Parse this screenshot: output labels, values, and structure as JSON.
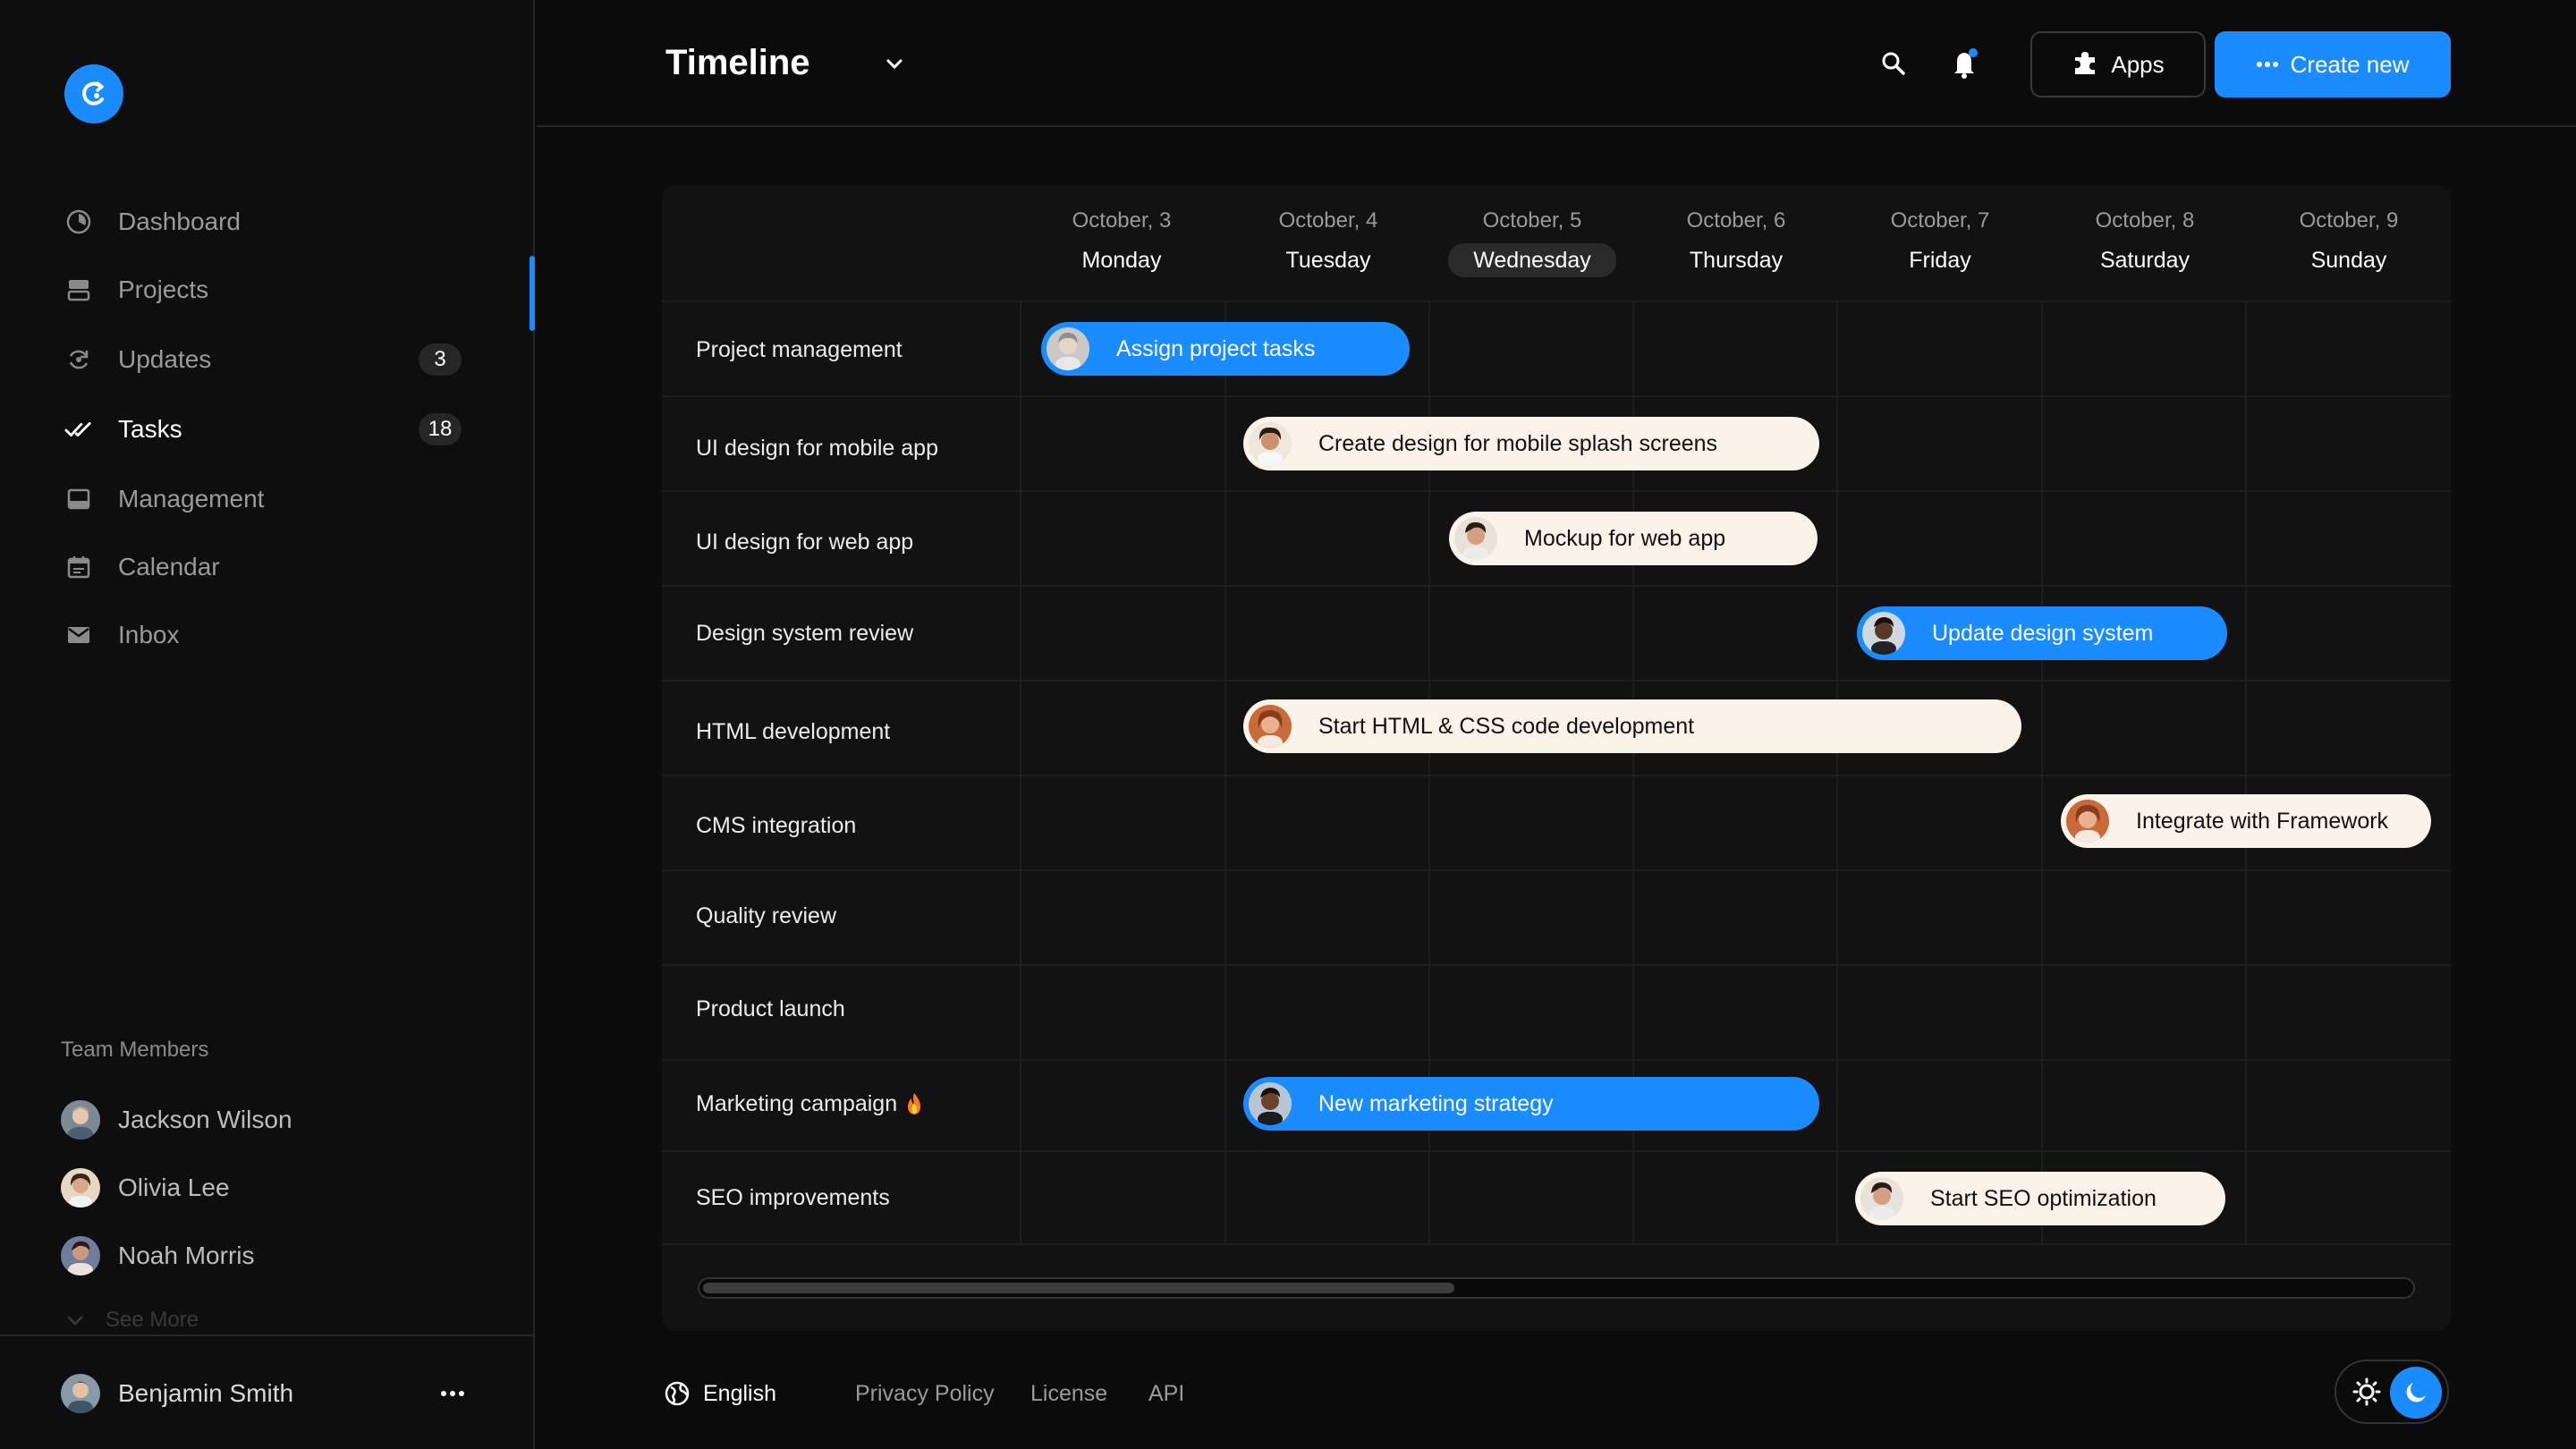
{
  "sidebar": {
    "nav": [
      {
        "label": "Dashboard",
        "icon": "dashboard-icon",
        "badge": ""
      },
      {
        "label": "Projects",
        "icon": "projects-icon",
        "badge": ""
      },
      {
        "label": "Updates",
        "icon": "updates-icon",
        "badge": "3"
      },
      {
        "label": "Tasks",
        "icon": "tasks-icon",
        "badge": "18",
        "active": true
      },
      {
        "label": "Management",
        "icon": "management-icon",
        "badge": ""
      },
      {
        "label": "Calendar",
        "icon": "calendar-icon",
        "badge": ""
      },
      {
        "label": "Inbox",
        "icon": "inbox-icon",
        "badge": ""
      }
    ],
    "team_title": "Team Members",
    "members": [
      "Jackson Wilson",
      "Olivia Lee",
      "Noah Morris"
    ],
    "see_more": "See More",
    "user": "Benjamin Smith"
  },
  "header": {
    "title": "Timeline",
    "apps_label": "Apps",
    "create_label": "Create new"
  },
  "timeline": {
    "days": [
      {
        "date": "October, 3",
        "day": "Monday"
      },
      {
        "date": "October, 4",
        "day": "Tuesday"
      },
      {
        "date": "October, 5",
        "day": "Wednesday",
        "today": true
      },
      {
        "date": "October, 6",
        "day": "Thursday"
      },
      {
        "date": "October, 7",
        "day": "Friday"
      },
      {
        "date": "October, 8",
        "day": "Saturday"
      },
      {
        "date": "October, 9",
        "day": "Sunday"
      }
    ],
    "rows": [
      {
        "label": "Project management",
        "task": "Assign project tasks",
        "style": "blue"
      },
      {
        "label": "UI design for mobile app",
        "task": "Create design for mobile splash screens",
        "style": "light"
      },
      {
        "label": "UI design for web app",
        "task": "Mockup for web app",
        "style": "light"
      },
      {
        "label": "Design system review",
        "task": "Update design system",
        "style": "blue"
      },
      {
        "label": "HTML development",
        "task": "Start HTML & CSS code development",
        "style": "light"
      },
      {
        "label": "CMS integration",
        "task": "Integrate with Framework",
        "style": "light"
      },
      {
        "label": "Quality review",
        "task": ""
      },
      {
        "label": "Product launch",
        "task": ""
      },
      {
        "label": "Marketing campaign",
        "task": "New marketing strategy",
        "style": "blue",
        "flag": "fire-icon"
      },
      {
        "label": "SEO improvements",
        "task": "Start SEO optimization",
        "style": "light"
      }
    ]
  },
  "footer": {
    "language": "English",
    "links": [
      "Privacy Policy",
      "License",
      "API"
    ]
  },
  "colors": {
    "accent": "#1a8cff",
    "background": "#0b0b0b",
    "panel": "#121212",
    "task_light": "#fbf3ea"
  }
}
